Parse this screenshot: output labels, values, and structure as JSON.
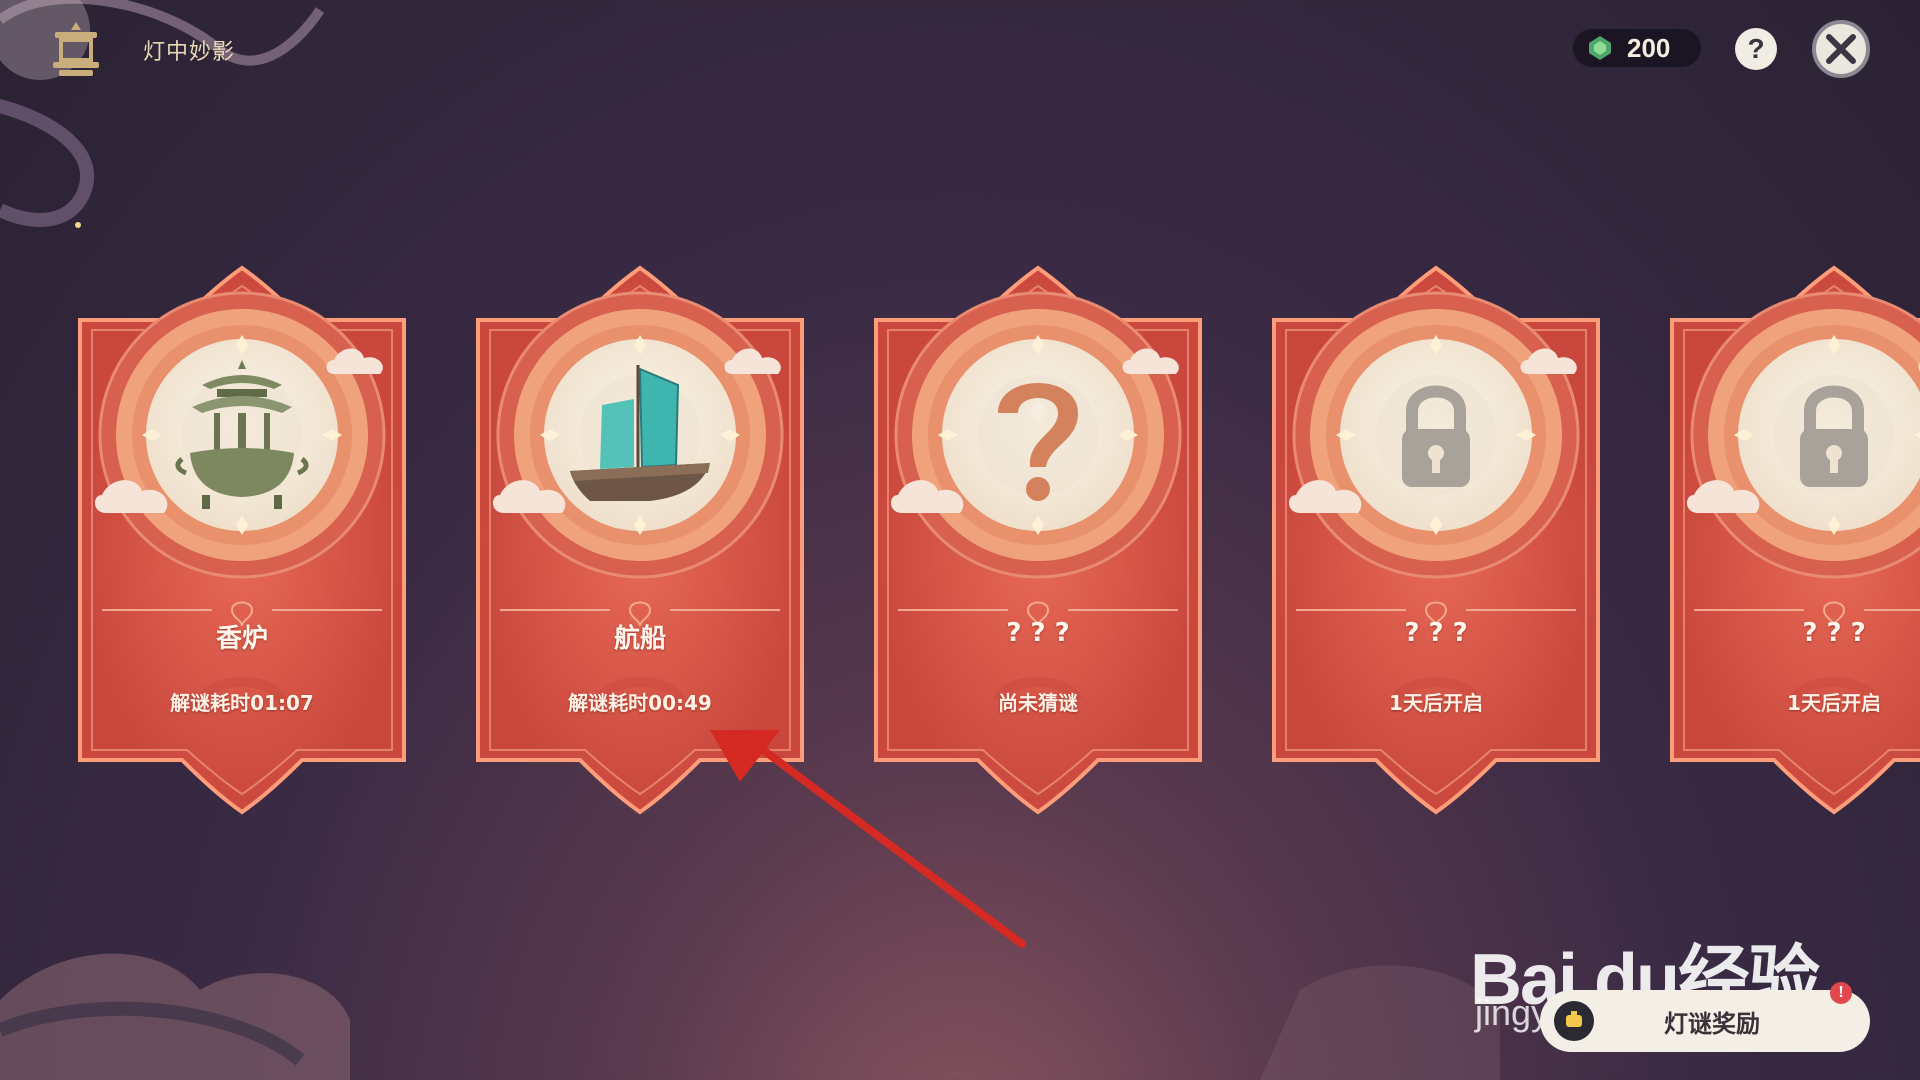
{
  "header": {
    "title": "灯中妙影",
    "emblem_icon": "pavilion-emblem-icon"
  },
  "currency": {
    "icon": "gem-icon",
    "value": "200"
  },
  "toolbar": {
    "help_label": "?",
    "close_icon": "close-icon"
  },
  "cards": [
    {
      "title": "香炉",
      "status": "解谜耗时01:07",
      "art": "censer"
    },
    {
      "title": "航船",
      "status": "解谜耗时00:49",
      "art": "junk-ship"
    },
    {
      "title": "? ? ?",
      "status": "尚未猜谜",
      "art": "question-mark"
    },
    {
      "title": "? ? ?",
      "status": "1天后开启",
      "art": "lock"
    },
    {
      "title": "? ? ?",
      "status": "1天后开启",
      "art": "lock"
    }
  ],
  "reward": {
    "label": "灯谜奖励",
    "badge": "!"
  },
  "watermark": {
    "brand": "Bai du经验",
    "sub": "jingyan.baidu.com"
  },
  "colors": {
    "card_red": "#d9574a",
    "card_border": "#ff9d7a",
    "medallion_cream": "#f6ede0",
    "annotation_arrow": "#d42a23"
  }
}
